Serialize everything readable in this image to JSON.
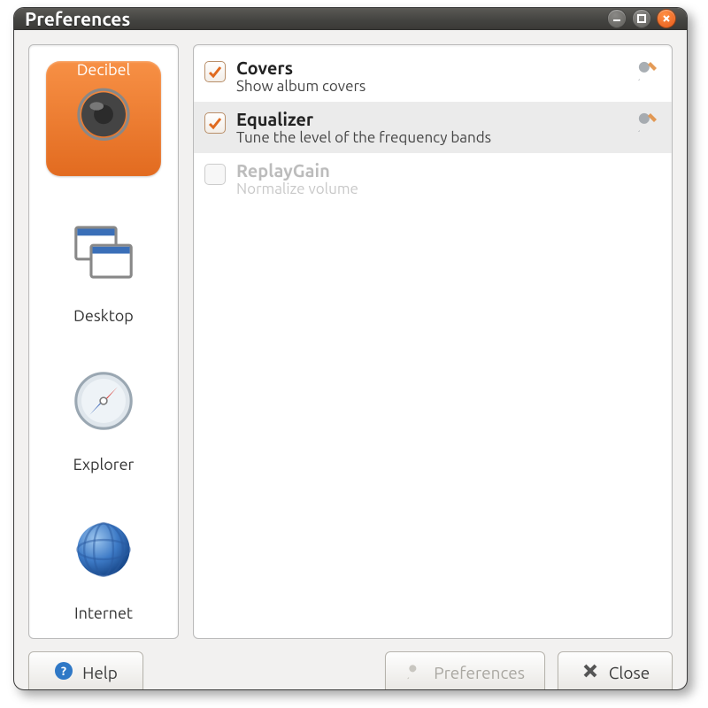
{
  "window": {
    "title": "Preferences"
  },
  "sidebar": {
    "items": [
      {
        "key": "decibel",
        "label": "Decibel",
        "selected": true
      },
      {
        "key": "desktop",
        "label": "Desktop",
        "selected": false
      },
      {
        "key": "explorer",
        "label": "Explorer",
        "selected": false
      },
      {
        "key": "internet",
        "label": "Internet",
        "selected": false
      }
    ]
  },
  "plugins": [
    {
      "title": "Covers",
      "desc": "Show album covers",
      "checked": true,
      "enabled": true,
      "selected": false
    },
    {
      "title": "Equalizer",
      "desc": "Tune the level of the frequency bands",
      "checked": true,
      "enabled": true,
      "selected": true
    },
    {
      "title": "ReplayGain",
      "desc": "Normalize volume",
      "checked": false,
      "enabled": false,
      "selected": false
    }
  ],
  "footer": {
    "help": "Help",
    "preferences": "Preferences",
    "close": "Close"
  },
  "colors": {
    "accent": "#e77427"
  }
}
